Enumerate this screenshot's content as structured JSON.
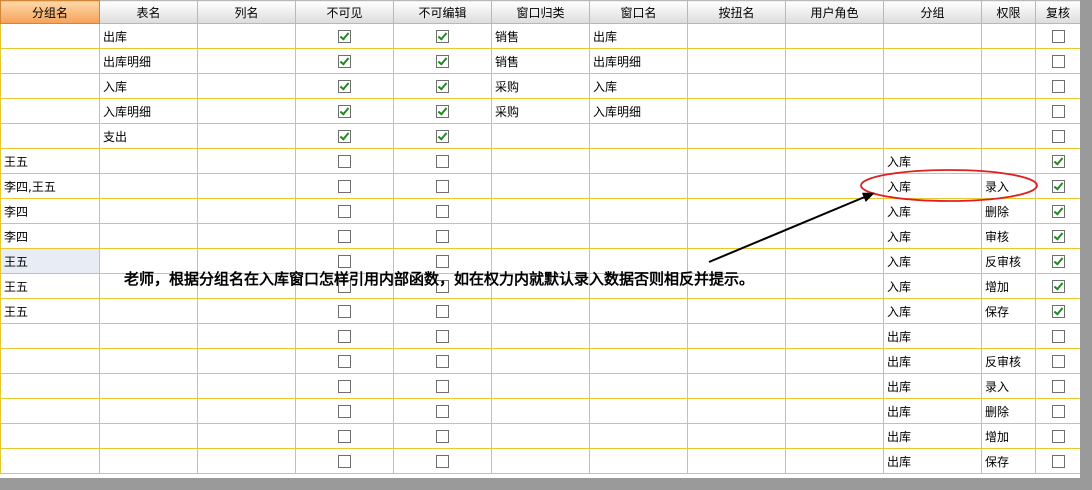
{
  "columns": [
    "分组名",
    "表名",
    "列名",
    "不可见",
    "不可编辑",
    "窗口归类",
    "窗口名",
    "按扭名",
    "用户角色",
    "分组",
    "权限",
    "复核"
  ],
  "rows": [
    {
      "group_name": "",
      "table_name": "出库",
      "column_name": "",
      "invisible": true,
      "not_editable": true,
      "window_category": "销售",
      "window_name": "出库",
      "button_name": "",
      "user_role": "",
      "group": "",
      "permission": "",
      "review": false
    },
    {
      "group_name": "",
      "table_name": "出库明细",
      "column_name": "",
      "invisible": true,
      "not_editable": true,
      "window_category": "销售",
      "window_name": "出库明细",
      "button_name": "",
      "user_role": "",
      "group": "",
      "permission": "",
      "review": false
    },
    {
      "group_name": "",
      "table_name": "入库",
      "column_name": "",
      "invisible": true,
      "not_editable": true,
      "window_category": "采购",
      "window_name": "入库",
      "button_name": "",
      "user_role": "",
      "group": "",
      "permission": "",
      "review": false
    },
    {
      "group_name": "",
      "table_name": "入库明细",
      "column_name": "",
      "invisible": true,
      "not_editable": true,
      "window_category": "采购",
      "window_name": "入库明细",
      "button_name": "",
      "user_role": "",
      "group": "",
      "permission": "",
      "review": false
    },
    {
      "group_name": "",
      "table_name": "支出",
      "column_name": "",
      "invisible": true,
      "not_editable": true,
      "window_category": "",
      "window_name": "",
      "button_name": "",
      "user_role": "",
      "group": "",
      "permission": "",
      "review": false
    },
    {
      "group_name": "王五",
      "table_name": "",
      "column_name": "",
      "invisible": false,
      "not_editable": false,
      "window_category": "",
      "window_name": "",
      "button_name": "",
      "user_role": "",
      "group": "入库",
      "permission": "",
      "review": true
    },
    {
      "group_name": "李四,王五",
      "table_name": "",
      "column_name": "",
      "invisible": false,
      "not_editable": false,
      "window_category": "",
      "window_name": "",
      "button_name": "",
      "user_role": "",
      "group": "入库",
      "permission": "录入",
      "review": true
    },
    {
      "group_name": "李四",
      "table_name": "",
      "column_name": "",
      "invisible": false,
      "not_editable": false,
      "window_category": "",
      "window_name": "",
      "button_name": "",
      "user_role": "",
      "group": "入库",
      "permission": "删除",
      "review": true
    },
    {
      "group_name": "李四",
      "table_name": "",
      "column_name": "",
      "invisible": false,
      "not_editable": false,
      "window_category": "",
      "window_name": "",
      "button_name": "",
      "user_role": "",
      "group": "入库",
      "permission": "审核",
      "review": true
    },
    {
      "group_name": "王五",
      "table_name": "",
      "column_name": "",
      "invisible": false,
      "not_editable": false,
      "window_category": "",
      "window_name": "",
      "button_name": "",
      "user_role": "",
      "group": "入库",
      "permission": "反审核",
      "review": true,
      "selected": true
    },
    {
      "group_name": "王五",
      "table_name": "",
      "column_name": "",
      "invisible": false,
      "not_editable": false,
      "window_category": "",
      "window_name": "",
      "button_name": "",
      "user_role": "",
      "group": "入库",
      "permission": "增加",
      "review": true
    },
    {
      "group_name": "王五",
      "table_name": "",
      "column_name": "",
      "invisible": false,
      "not_editable": false,
      "window_category": "",
      "window_name": "",
      "button_name": "",
      "user_role": "",
      "group": "入库",
      "permission": "保存",
      "review": true
    },
    {
      "group_name": "",
      "table_name": "",
      "column_name": "",
      "invisible": false,
      "not_editable": false,
      "window_category": "",
      "window_name": "",
      "button_name": "",
      "user_role": "",
      "group": "出库",
      "permission": "",
      "review": false
    },
    {
      "group_name": "",
      "table_name": "",
      "column_name": "",
      "invisible": false,
      "not_editable": false,
      "window_category": "",
      "window_name": "",
      "button_name": "",
      "user_role": "",
      "group": "出库",
      "permission": "反审核",
      "review": false
    },
    {
      "group_name": "",
      "table_name": "",
      "column_name": "",
      "invisible": false,
      "not_editable": false,
      "window_category": "",
      "window_name": "",
      "button_name": "",
      "user_role": "",
      "group": "出库",
      "permission": "录入",
      "review": false
    },
    {
      "group_name": "",
      "table_name": "",
      "column_name": "",
      "invisible": false,
      "not_editable": false,
      "window_category": "",
      "window_name": "",
      "button_name": "",
      "user_role": "",
      "group": "出库",
      "permission": "删除",
      "review": false
    },
    {
      "group_name": "",
      "table_name": "",
      "column_name": "",
      "invisible": false,
      "not_editable": false,
      "window_category": "",
      "window_name": "",
      "button_name": "",
      "user_role": "",
      "group": "出库",
      "permission": "增加",
      "review": false
    },
    {
      "group_name": "",
      "table_name": "",
      "column_name": "",
      "invisible": false,
      "not_editable": false,
      "window_category": "",
      "window_name": "",
      "button_name": "",
      "user_role": "",
      "group": "出库",
      "permission": "保存",
      "review": false
    }
  ],
  "annotation": {
    "text": "老师，根据分组名在入库窗口怎样引用内部函数，如在权力内就默认录入数据否则相反并提示。",
    "highlight_row": 6,
    "highlight_color": "#e02020",
    "arrow_color": "#000000"
  },
  "colors": {
    "grid_line": "#e8c830",
    "active_header": "#f5a259",
    "check_mark": "#1f8a1f"
  }
}
